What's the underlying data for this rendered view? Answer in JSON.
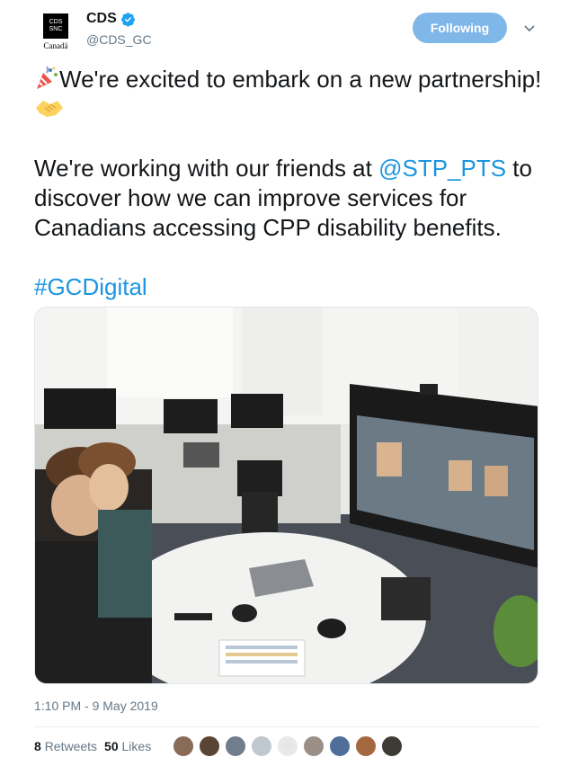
{
  "account": {
    "display_name": "CDS",
    "handle": "@CDS_GC",
    "logo_text": "CDS SNC",
    "logo_wordmark": "Canadä"
  },
  "follow_button": {
    "label": "Following"
  },
  "tweet": {
    "line1_part1": "We're excited to embark on a new partnership!",
    "line2_prefix": "We're working with our friends at ",
    "mention": "@STP_PTS",
    "line2_suffix": " to discover how we can improve services for Canadians accessing CPP disability benefits.",
    "hashtag": "#GCDigital"
  },
  "timestamp": "1:10 PM - 9 May 2019",
  "stats": {
    "retweets_count": "8",
    "retweets_label": "Retweets",
    "likes_count": "50",
    "likes_label": "Likes"
  },
  "icons": {
    "verified": "verified-badge-icon",
    "chevron": "chevron-down-icon",
    "party": "party-popper-icon",
    "handshake": "handshake-icon"
  },
  "colors": {
    "link": "#1b95e0",
    "follow_bg": "#7fb7e8",
    "muted": "#657786"
  }
}
